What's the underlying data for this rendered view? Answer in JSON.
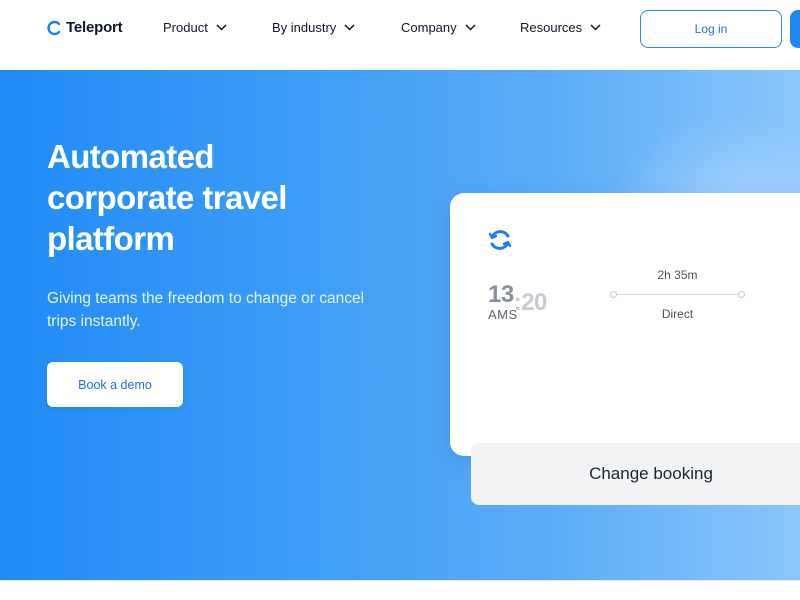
{
  "nav": {
    "brand": "Teleport",
    "items": [
      {
        "label": "Product"
      },
      {
        "label": "By industry"
      },
      {
        "label": "Company"
      },
      {
        "label": "Resources"
      }
    ],
    "login_label": "Log in"
  },
  "hero": {
    "title": "Automated corporate travel platform",
    "subtitle": "Giving teams the freedom to change or cancel trips instantly.",
    "cta_label": "Book a demo"
  },
  "card": {
    "time_hh": "13",
    "time_mm": ":20",
    "airport": "AMS",
    "duration": "2h 35m",
    "route_type": "Direct",
    "change_label": "Change booking"
  },
  "colors": {
    "accent": "#2185f2",
    "hero_start": "#1f8af6",
    "hero_end": "#8cc6fb"
  }
}
